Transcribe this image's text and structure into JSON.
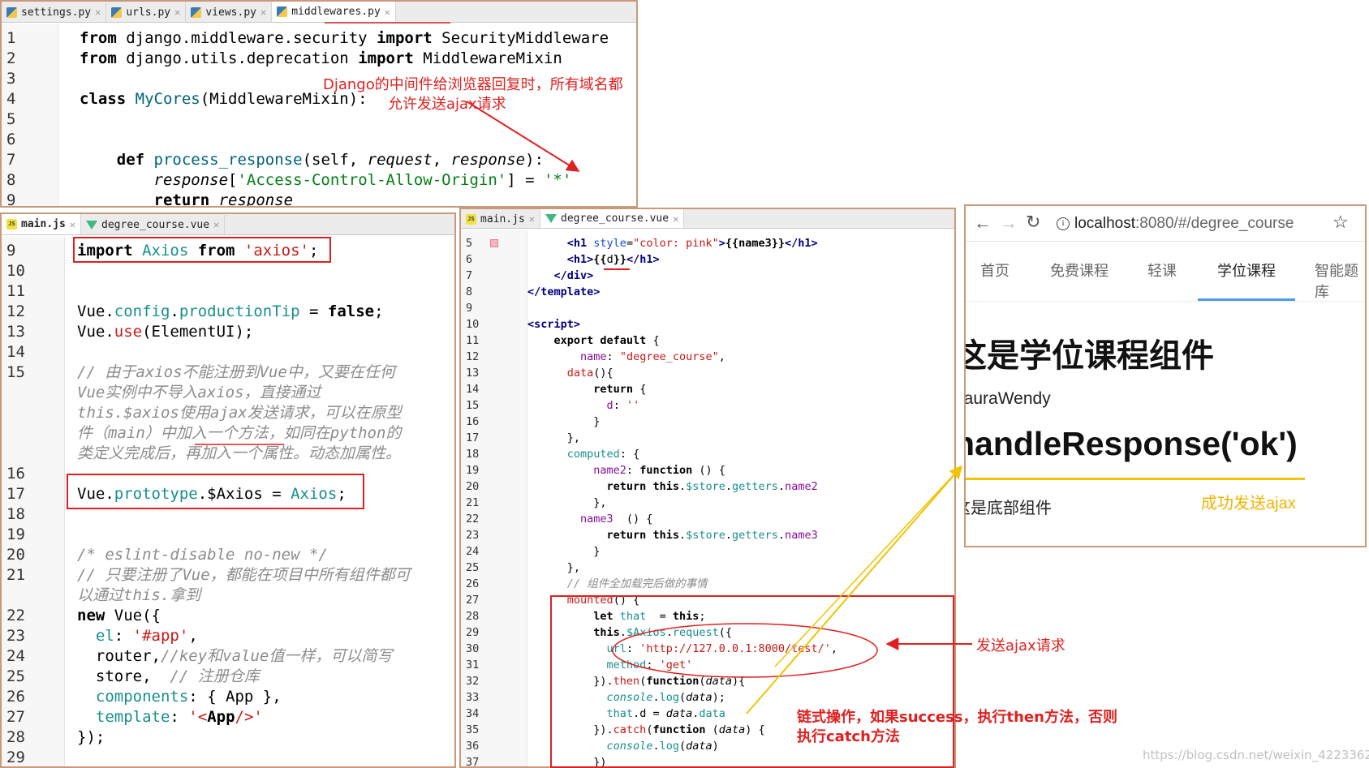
{
  "settings_panel": {
    "tabs": [
      "settings.py",
      "urls.py",
      "views.py",
      "middlewares.py"
    ],
    "lines": [
      {
        "n": "1",
        "parts": [
          [
            "kwb",
            "from "
          ],
          [
            "",
            "django.middleware.security "
          ],
          [
            "kwb",
            "import "
          ],
          [
            "",
            "SecurityMiddleware"
          ]
        ]
      },
      {
        "n": "2",
        "parts": [
          [
            "kwb",
            "from "
          ],
          [
            "",
            "django.utils.deprecation "
          ],
          [
            "kwb",
            "import "
          ],
          [
            "",
            "MiddlewareMixin"
          ]
        ]
      },
      {
        "n": "3",
        "parts": []
      },
      {
        "n": "4",
        "parts": [
          [
            "kwb",
            "class "
          ],
          [
            "fn",
            "MyCores"
          ],
          [
            "",
            "(MiddlewareMixin):"
          ]
        ]
      },
      {
        "n": "5",
        "parts": []
      },
      {
        "n": "6",
        "parts": []
      },
      {
        "n": "7",
        "parts": [
          [
            "",
            "    "
          ],
          [
            "kwb",
            "def "
          ],
          [
            "fn",
            "process_response"
          ],
          [
            "",
            "(self, "
          ],
          [
            "it",
            "request"
          ],
          [
            "",
            ", "
          ],
          [
            "it",
            "response"
          ],
          [
            "",
            "):"
          ]
        ]
      },
      {
        "n": "8",
        "parts": [
          [
            "",
            "        "
          ],
          [
            "it",
            "response"
          ],
          [
            "",
            "["
          ],
          [
            "str",
            "'Access-Control-Allow-Origin'"
          ],
          [
            "",
            "] = "
          ],
          [
            "str",
            "'*'"
          ]
        ]
      },
      {
        "n": "9",
        "parts": [
          [
            "",
            "        "
          ],
          [
            "kwb",
            "return "
          ],
          [
            "it",
            "response"
          ]
        ]
      }
    ],
    "annotation_line1": "Django的中间件给浏览器回复时，所有域名都",
    "annotation_line2": "允许发送ajax请求"
  },
  "mainjs_panel": {
    "tabs": [
      "main.js",
      "degree_course.vue"
    ],
    "lines": [
      {
        "n": "9",
        "parts": [
          [
            "kwb",
            "import "
          ],
          [
            "tealt",
            "Axios "
          ],
          [
            "kwb",
            "from "
          ],
          [
            "strr",
            "'axios'"
          ],
          [
            "",
            ";"
          ]
        ]
      },
      {
        "n": "10",
        "parts": []
      },
      {
        "n": "11",
        "parts": []
      },
      {
        "n": "12",
        "parts": [
          [
            "",
            "Vue."
          ],
          [
            "tealt",
            "config"
          ],
          [
            "",
            "."
          ],
          [
            "tealt",
            "productionTip"
          ],
          [
            "",
            " = "
          ],
          [
            "kwb",
            "false"
          ],
          [
            "",
            ";"
          ]
        ]
      },
      {
        "n": "13",
        "parts": [
          [
            "",
            "Vue."
          ],
          [
            "strr",
            "use"
          ],
          [
            "",
            "(ElementUI);"
          ]
        ]
      },
      {
        "n": "14",
        "parts": []
      },
      {
        "n": "15",
        "parts": [
          [
            "cm",
            "// 由于axios不能注册到Vue中，又要在任何"
          ]
        ]
      },
      {
        "n": "",
        "parts": [
          [
            "cm",
            "Vue实例中不导入axios，直接通过"
          ]
        ]
      },
      {
        "n": "",
        "parts": [
          [
            "cm",
            "this.$axios使用ajax发送请求，可以在原型"
          ]
        ]
      },
      {
        "n": "",
        "parts": [
          [
            "cm",
            "件（main）中加入一个方法，如同在python的"
          ]
        ]
      },
      {
        "n": "",
        "parts": [
          [
            "cm",
            "类定义完成后，再加入一个属性。动态加属性。"
          ]
        ]
      },
      {
        "n": "16",
        "parts": []
      },
      {
        "n": "17",
        "parts": [
          [
            "",
            "Vue."
          ],
          [
            "tealt",
            "prototype"
          ],
          [
            "",
            ".$Axios = "
          ],
          [
            "tealt",
            "Axios"
          ],
          [
            "",
            ";"
          ]
        ]
      },
      {
        "n": "18",
        "parts": []
      },
      {
        "n": "19",
        "parts": []
      },
      {
        "n": "20",
        "parts": [
          [
            "cm",
            "/* eslint-disable no-new */"
          ]
        ]
      },
      {
        "n": "21",
        "parts": [
          [
            "cm",
            "// 只要注册了Vue，都能在项目中所有组件都可"
          ]
        ]
      },
      {
        "n": "",
        "parts": [
          [
            "cm",
            "以通过this.拿到"
          ]
        ]
      },
      {
        "n": "22",
        "parts": [
          [
            "kwb",
            "new "
          ],
          [
            "",
            "Vue({"
          ]
        ]
      },
      {
        "n": "23",
        "parts": [
          [
            "",
            "  "
          ],
          [
            "tealt",
            "el"
          ],
          [
            "",
            ": "
          ],
          [
            "strr",
            "'#app'"
          ],
          [
            "",
            ","
          ]
        ]
      },
      {
        "n": "24",
        "parts": [
          [
            "",
            "  router,"
          ],
          [
            "cm",
            "//key和value值一样，可以简写"
          ]
        ]
      },
      {
        "n": "25",
        "parts": [
          [
            "",
            "  store,  "
          ],
          [
            "cm",
            "// 注册仓库"
          ]
        ]
      },
      {
        "n": "26",
        "parts": [
          [
            "",
            "  "
          ],
          [
            "tealt",
            "components"
          ],
          [
            "",
            ": { App },"
          ]
        ]
      },
      {
        "n": "27",
        "parts": [
          [
            "",
            "  "
          ],
          [
            "tealt",
            "template"
          ],
          [
            "",
            ": "
          ],
          [
            "strr",
            "'<"
          ],
          [
            "kwb",
            "App"
          ],
          [
            "strr",
            "/>'"
          ]
        ]
      },
      {
        "n": "28",
        "parts": [
          [
            "",
            "});"
          ]
        ]
      },
      {
        "n": "29",
        "parts": []
      }
    ]
  },
  "vue_panel": {
    "tabs": [
      "main.js",
      "degree_course.vue"
    ],
    "lines": [
      {
        "n": "5",
        "parts": [
          [
            "",
            "      "
          ],
          [
            "tag",
            "<h1 "
          ],
          [
            "attr",
            "style"
          ],
          [
            "",
            "="
          ],
          [
            "strr",
            "\"color: pink\""
          ],
          [
            "tag",
            ">"
          ],
          [
            "kwb",
            "{{name3}}"
          ],
          [
            "tag",
            "</h1>"
          ]
        ]
      },
      {
        "n": "6",
        "parts": [
          [
            "",
            "      "
          ],
          [
            "tag",
            "<h1>"
          ],
          [
            "kwb",
            "{{"
          ],
          [
            "",
            "d"
          ],
          [
            "kwb",
            "}}"
          ],
          [
            "tag",
            "</h1>"
          ]
        ]
      },
      {
        "n": "7",
        "parts": [
          [
            "",
            "    "
          ],
          [
            "tag",
            "</div>"
          ]
        ]
      },
      {
        "n": "8",
        "parts": [
          [
            "tag",
            "</template>"
          ]
        ]
      },
      {
        "n": "9",
        "parts": []
      },
      {
        "n": "10",
        "parts": [
          [
            "tag",
            "<script>"
          ]
        ]
      },
      {
        "n": "11",
        "parts": [
          [
            "",
            "    "
          ],
          [
            "kwb",
            "export default "
          ],
          [
            "",
            "{"
          ]
        ]
      },
      {
        "n": "12",
        "parts": [
          [
            "",
            "        "
          ],
          [
            "purple",
            "name"
          ],
          [
            "",
            ": "
          ],
          [
            "strr",
            "\"degree_course\""
          ],
          [
            "",
            ","
          ]
        ]
      },
      {
        "n": "13",
        "parts": [
          [
            "",
            "      "
          ],
          [
            "strr",
            "data"
          ],
          [
            "",
            "(){"
          ]
        ]
      },
      {
        "n": "14",
        "parts": [
          [
            "",
            "          "
          ],
          [
            "kwb",
            "return "
          ],
          [
            "",
            "{"
          ]
        ]
      },
      {
        "n": "15",
        "parts": [
          [
            "",
            "            "
          ],
          [
            "purple",
            "d"
          ],
          [
            "",
            ": "
          ],
          [
            "strr",
            "''"
          ]
        ]
      },
      {
        "n": "16",
        "parts": [
          [
            "",
            "          }"
          ]
        ]
      },
      {
        "n": "17",
        "parts": [
          [
            "",
            "      },"
          ]
        ]
      },
      {
        "n": "18",
        "parts": [
          [
            "",
            "      "
          ],
          [
            "tealt",
            "computed"
          ],
          [
            "",
            ": {"
          ]
        ]
      },
      {
        "n": "19",
        "parts": [
          [
            "",
            "          "
          ],
          [
            "purple",
            "name2"
          ],
          [
            "",
            ": "
          ],
          [
            "kwb",
            "function "
          ],
          [
            "",
            "() {"
          ]
        ]
      },
      {
        "n": "20",
        "parts": [
          [
            "",
            "            "
          ],
          [
            "kwb",
            "return this"
          ],
          [
            "",
            "."
          ],
          [
            "tealt",
            "$store"
          ],
          [
            "",
            "."
          ],
          [
            "tealt",
            "getters"
          ],
          [
            "",
            "."
          ],
          [
            "purple",
            "name2"
          ]
        ]
      },
      {
        "n": "21",
        "parts": [
          [
            "",
            "          },"
          ]
        ]
      },
      {
        "n": "22",
        "parts": [
          [
            "",
            "        "
          ],
          [
            "purple",
            "name3"
          ],
          [
            "",
            "  () {"
          ]
        ]
      },
      {
        "n": "23",
        "parts": [
          [
            "",
            "            "
          ],
          [
            "kwb",
            "return this"
          ],
          [
            "",
            "."
          ],
          [
            "tealt",
            "$store"
          ],
          [
            "",
            "."
          ],
          [
            "tealt",
            "getters"
          ],
          [
            "",
            "."
          ],
          [
            "purple",
            "name3"
          ]
        ]
      },
      {
        "n": "24",
        "parts": [
          [
            "",
            "          }"
          ]
        ]
      },
      {
        "n": "25",
        "parts": [
          [
            "",
            "      },"
          ]
        ]
      },
      {
        "n": "26",
        "parts": [
          [
            "",
            "      "
          ],
          [
            "cm",
            "// 组件全加载完后做的事情"
          ]
        ]
      },
      {
        "n": "27",
        "parts": [
          [
            "",
            "      "
          ],
          [
            "strr",
            "mounted"
          ],
          [
            "",
            "() {"
          ]
        ]
      },
      {
        "n": "28",
        "parts": [
          [
            "",
            "          "
          ],
          [
            "kwb",
            "let "
          ],
          [
            "tealt",
            "that "
          ],
          [
            "",
            " = "
          ],
          [
            "kwb",
            "this"
          ],
          [
            "",
            ";"
          ]
        ]
      },
      {
        "n": "29",
        "parts": [
          [
            "",
            "          "
          ],
          [
            "kwb",
            "this"
          ],
          [
            "",
            "."
          ],
          [
            "tealt",
            "$Axios"
          ],
          [
            "",
            "."
          ],
          [
            "tealt",
            "request"
          ],
          [
            "",
            "({"
          ]
        ]
      },
      {
        "n": "30",
        "parts": [
          [
            "",
            "            "
          ],
          [
            "tealt",
            "url"
          ],
          [
            "",
            ": "
          ],
          [
            "strr",
            "'http://127.0.0.1:8000/test/'"
          ],
          [
            "",
            ","
          ]
        ]
      },
      {
        "n": "31",
        "parts": [
          [
            "",
            "            "
          ],
          [
            "tealt",
            "method"
          ],
          [
            "",
            ": "
          ],
          [
            "strr",
            "'get'"
          ]
        ]
      },
      {
        "n": "32",
        "parts": [
          [
            "",
            "          })."
          ],
          [
            "strr",
            "then"
          ],
          [
            "",
            "("
          ],
          [
            "kwb",
            "function"
          ],
          [
            "",
            "("
          ],
          [
            "it",
            "data"
          ],
          [
            "",
            "){"
          ]
        ]
      },
      {
        "n": "33",
        "parts": [
          [
            "",
            "            "
          ],
          [
            "it tealt",
            "console"
          ],
          [
            "",
            "."
          ],
          [
            "tealt",
            "log"
          ],
          [
            "",
            "("
          ],
          [
            "it",
            "data"
          ],
          [
            "",
            ");"
          ]
        ]
      },
      {
        "n": "34",
        "parts": [
          [
            "",
            "            "
          ],
          [
            "tealt",
            "that"
          ],
          [
            "",
            ".d = "
          ],
          [
            "it",
            "data"
          ],
          [
            "",
            "."
          ],
          [
            "tealt",
            "data"
          ]
        ]
      },
      {
        "n": "35",
        "parts": [
          [
            "",
            "          })."
          ],
          [
            "strr",
            "catch"
          ],
          [
            "",
            "("
          ],
          [
            "kwb",
            "function "
          ],
          [
            "",
            "("
          ],
          [
            "it",
            "data"
          ],
          [
            "",
            ") {"
          ]
        ]
      },
      {
        "n": "36",
        "parts": [
          [
            "",
            "            "
          ],
          [
            "it tealt",
            "console"
          ],
          [
            "",
            "."
          ],
          [
            "tealt",
            "log"
          ],
          [
            "",
            "("
          ],
          [
            "it",
            "data"
          ],
          [
            "",
            ")"
          ]
        ]
      },
      {
        "n": "37",
        "parts": [
          [
            "",
            "          })"
          ]
        ]
      }
    ],
    "annotation_send": "发送ajax请求",
    "annotation_chain1": "链式操作，如果success，执行then方法，否则",
    "annotation_chain2": "执行catch方法"
  },
  "browser": {
    "url_host": "localhost",
    "url_rest": ":8080/#/degree_course",
    "nav": [
      "首页",
      "免费课程",
      "轻课",
      "学位课程",
      "智能题库"
    ],
    "active_nav": "学位课程",
    "heading": "这是学位课程组件",
    "name_text": "LauraWendy",
    "response_text": "handleResponse('ok')",
    "footer_text": "这是底部组件",
    "success_label": "成功发送ajax"
  },
  "watermark": "https://blog.csdn.net/weixin_42233629"
}
